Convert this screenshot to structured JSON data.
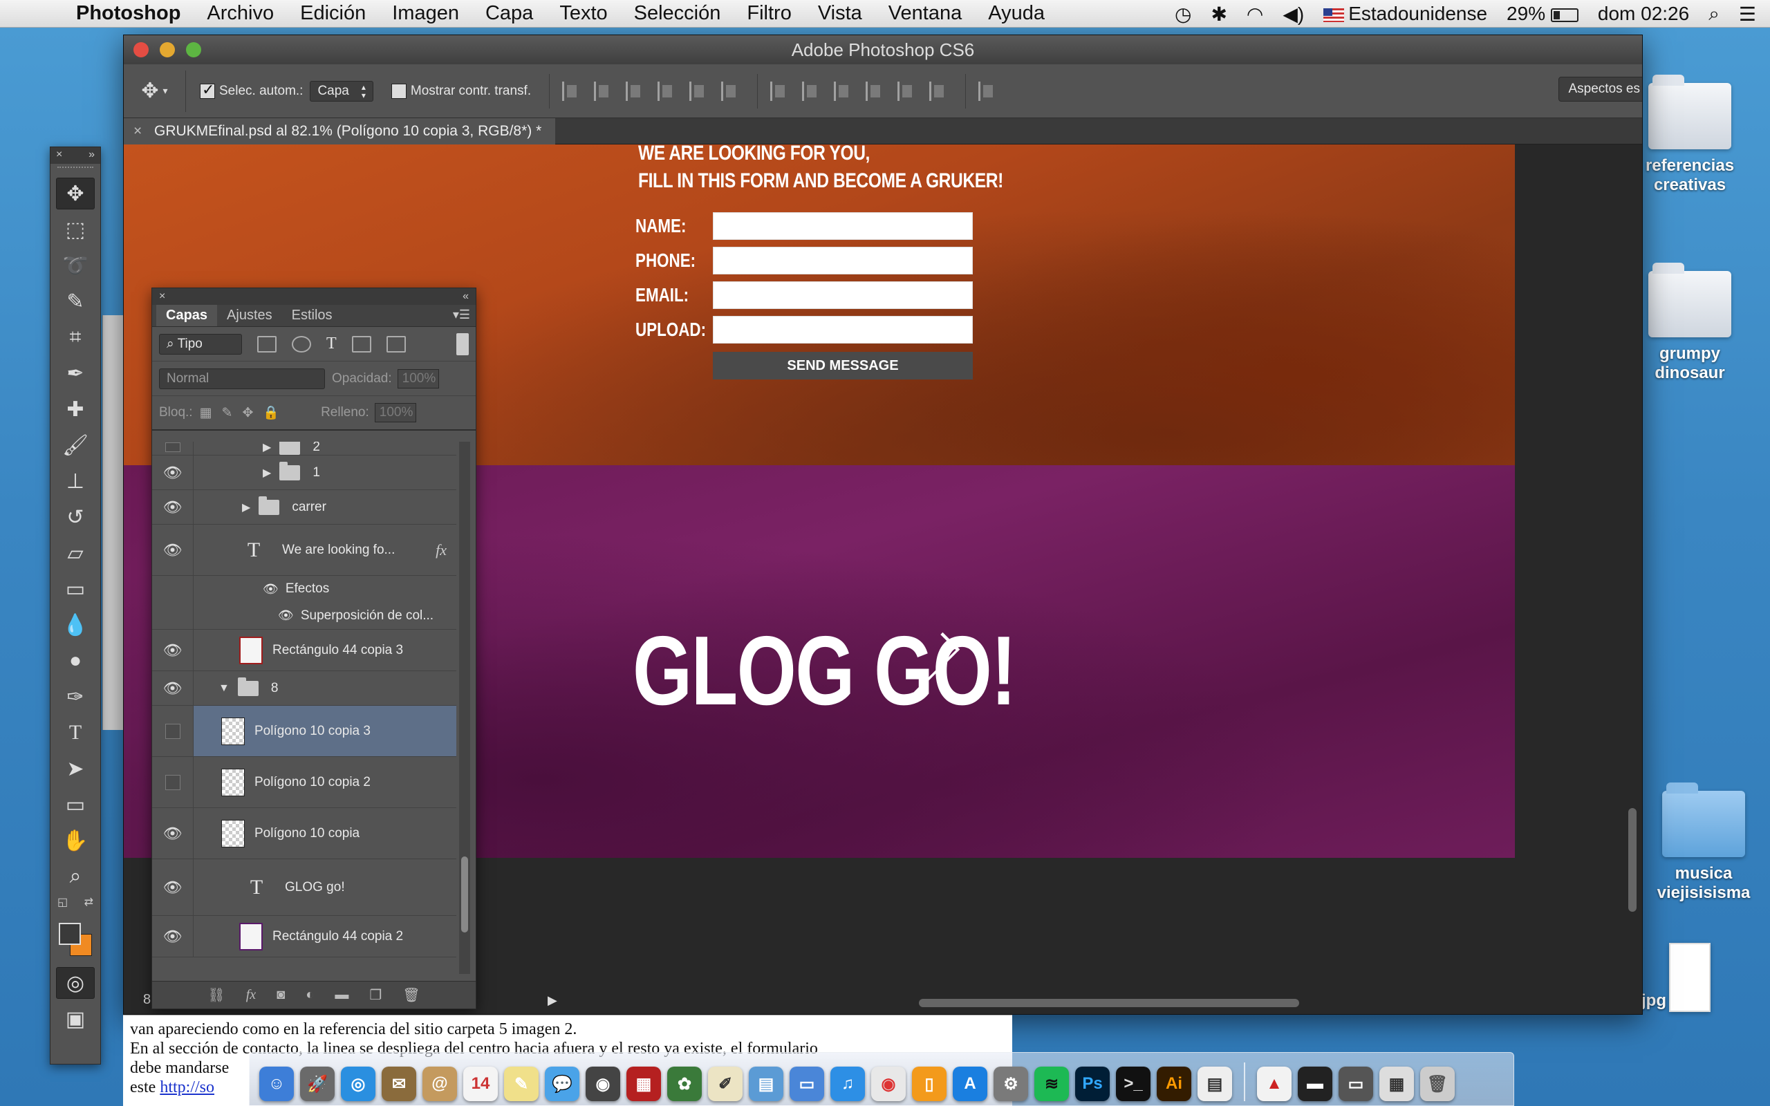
{
  "menubar": {
    "app_name": "Photoshop",
    "items": [
      "Archivo",
      "Edición",
      "Imagen",
      "Capa",
      "Texto",
      "Selección",
      "Filtro",
      "Vista",
      "Ventana",
      "Ayuda"
    ],
    "input_source": "Estadounidense",
    "battery": "29%",
    "clock": "dom 02:26"
  },
  "window": {
    "title": "Adobe Photoshop CS6"
  },
  "options_bar": {
    "auto_select_label": "Selec. autom.:",
    "auto_select_value": "Capa",
    "transform_label": "Mostrar contr. transf.",
    "workspace_label": "Aspectos es"
  },
  "document": {
    "tab_title": "GRUKMEfinal.psd al 82.1% (Polígono 10 copia 3, RGB/8*) *",
    "status_number": "8"
  },
  "artwork": {
    "headline_1": "WE ARE LOOKING FOR YOU,",
    "headline_2": "FILL IN THIS FORM AND BECOME A GRUKER!",
    "form_labels": [
      "NAME:",
      "PHONE:",
      "EMAIL:",
      "UPLOAD:"
    ],
    "send_button": "SEND MESSAGE",
    "cta": "GLOG GO!"
  },
  "layers_panel": {
    "tabs": [
      "Capas",
      "Ajustes",
      "Estilos"
    ],
    "filter_kind": "Tipo",
    "blend_mode": "Normal",
    "opacity_label": "Opacidad:",
    "opacity_value": "100%",
    "lock_label": "Bloq.:",
    "fill_label": "Relleno:",
    "fill_value": "100%",
    "layers": [
      {
        "name": "2"
      },
      {
        "name": "1"
      },
      {
        "name": "carrer"
      },
      {
        "name": "We are looking fo..."
      },
      {
        "name": "Efectos"
      },
      {
        "name": "Superposición de col..."
      },
      {
        "name": "Rectángulo 44 copia 3"
      },
      {
        "name": "8"
      },
      {
        "name": "Polígono 10 copia 3"
      },
      {
        "name": "Polígono 10 copia 2"
      },
      {
        "name": "Polígono 10 copia"
      },
      {
        "name": "GLOG go!"
      },
      {
        "name": "Rectángulo 44 copia 2"
      }
    ]
  },
  "note": {
    "line_1": "van apareciendo como en la referencia del sitio  carpeta 5 imagen 2.",
    "line_2": "En al sección de contacto, la linea se despliega del centro hacia afuera y el resto ya existe, el formulario",
    "line_3": "debe mandarse",
    "line_4_prefix": "este ",
    "link": "http://so"
  },
  "desktop_icons": [
    {
      "label_1": "referencias",
      "label_2": "creativas"
    },
    {
      "label_1": "grumpy",
      "label_2": "dinosaur"
    },
    {
      "label_1": "musica",
      "label_2": "viejisisisma"
    },
    {
      "label_1": "aljpg",
      "label_2": ""
    }
  ],
  "dock": {
    "labels": [
      "Ps",
      "Ai"
    ]
  },
  "colors": {
    "accent_selected_layer": "#5e6f88",
    "foreground_swatch": "#3a3a3a",
    "background_swatch": "#f08a22",
    "artwork_orange": "#b84b1b",
    "artwork_purple": "#6b1a55"
  }
}
